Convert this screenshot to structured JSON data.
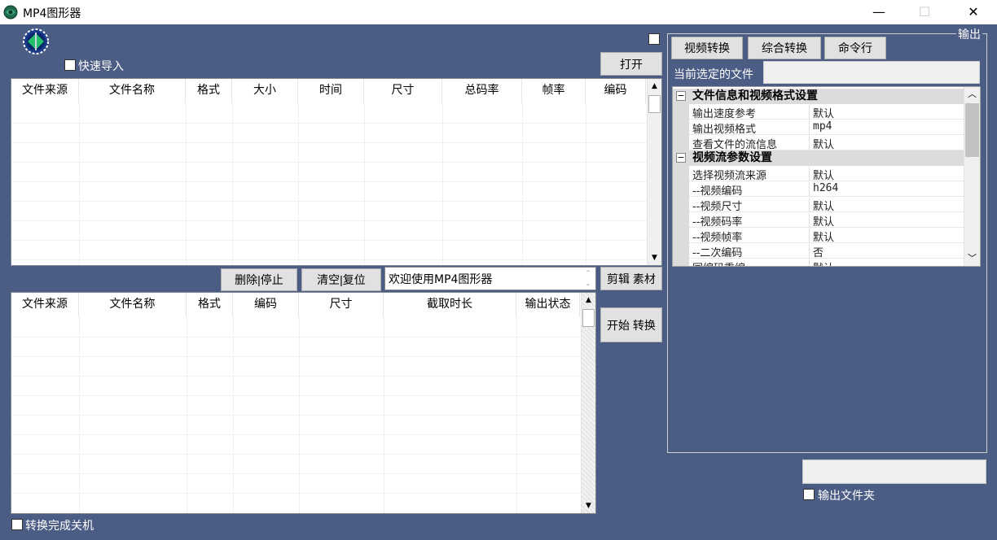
{
  "window": {
    "title": "MP4图形器",
    "minimize": "—",
    "maximize": "☐",
    "close": "✕"
  },
  "toolbar": {
    "quick_import_label": "快速导入",
    "open_label": "打开"
  },
  "top_table": {
    "columns": [
      "文件来源",
      "文件名称",
      "格式",
      "大小",
      "时间",
      "尺寸",
      "总码率",
      "帧率",
      "编码"
    ]
  },
  "actions": {
    "delete_stop": "删除|停止",
    "clear_reset": "清空|复位",
    "status_message": "欢迎使用MP4图形器",
    "clip_material": "剪辑 素材",
    "start_convert": "开始 转换"
  },
  "bottom_table": {
    "columns": [
      "文件来源",
      "文件名称",
      "格式",
      "编码",
      "尺寸",
      "截取时长",
      "输出状态"
    ]
  },
  "shutdown_label": "转换完成关机",
  "output_panel": {
    "group_label": "输出",
    "tabs": [
      "视频转换",
      "综合转换",
      "命令行"
    ],
    "current_file_label": "当前选定的文件",
    "current_file_value": "",
    "categories": [
      {
        "title": "文件信息和视频格式设置",
        "props": [
          {
            "name": "输出速度参考",
            "value": "默认"
          },
          {
            "name": "输出视频格式",
            "value": "mp4"
          },
          {
            "name": "查看文件的流信息",
            "value": "默认"
          }
        ]
      },
      {
        "title": "视频流参数设置",
        "props": [
          {
            "name": "选择视频流来源",
            "value": "默认"
          },
          {
            "name": "--视频编码",
            "value": "h264"
          },
          {
            "name": "--视频尺寸",
            "value": "默认"
          },
          {
            "name": "--视频码率",
            "value": "默认"
          },
          {
            "name": "--视频帧率",
            "value": "默认"
          },
          {
            "name": "--二次编码",
            "value": "否"
          },
          {
            "name": "同编码重编",
            "value": "默认"
          }
        ]
      }
    ],
    "output_folder_value": "",
    "output_folder_label": "输出文件夹"
  }
}
